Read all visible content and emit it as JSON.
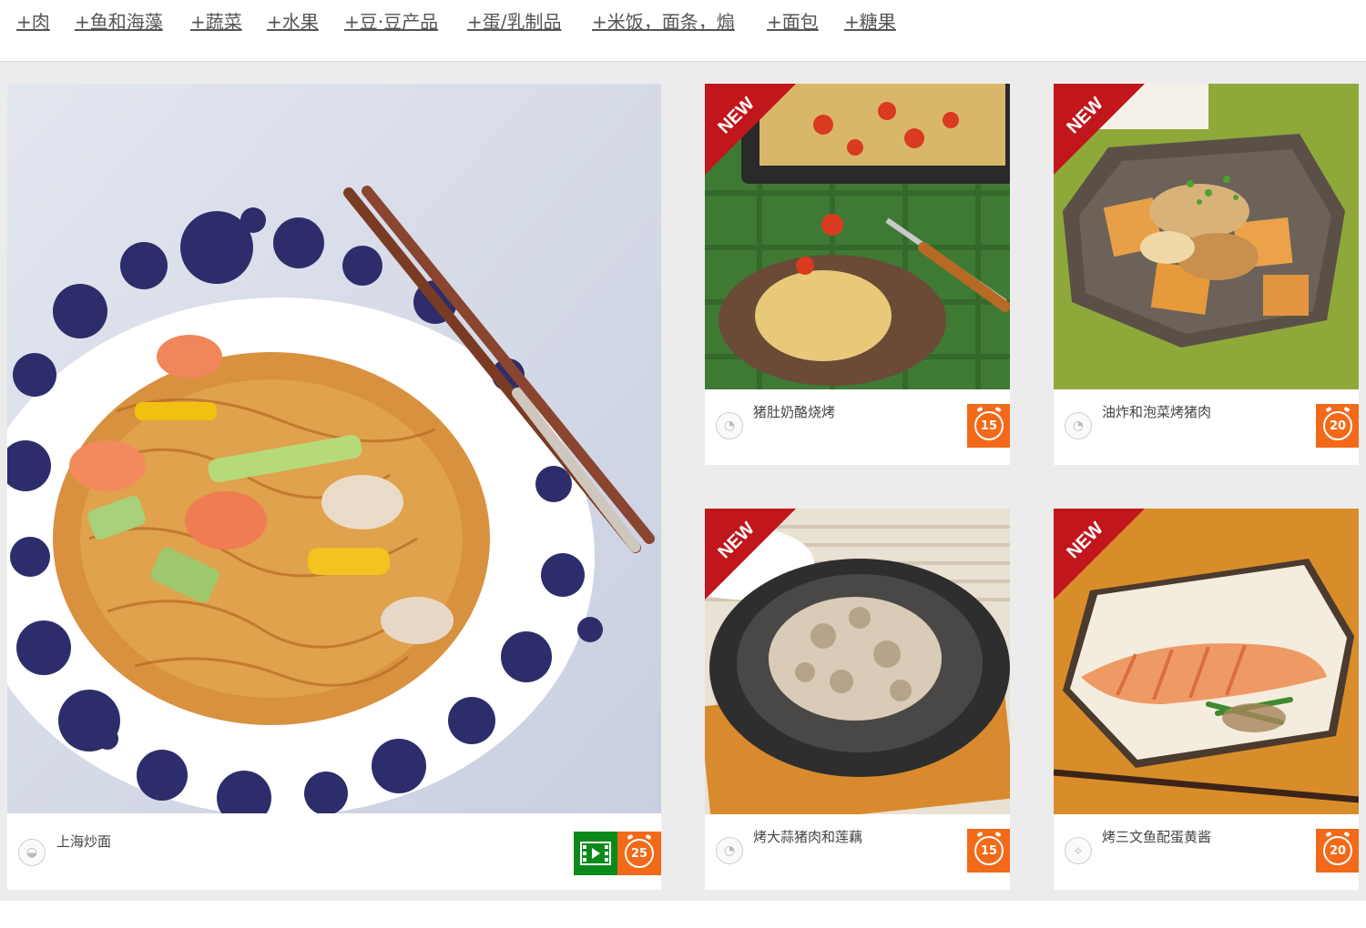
{
  "nav": {
    "links": [
      "+肉",
      "+鱼和海藻",
      "+蔬菜",
      "+水果",
      "+豆·豆产品",
      "+蛋/乳制品",
      "+米饭，面条，煽",
      "+面包",
      "+糖果"
    ]
  },
  "colors": {
    "timer_orange": "#f26a19",
    "video_green": "#0b8a1c",
    "new_badge_red": "#c1161c",
    "grid_bg": "#ececec"
  },
  "cards": {
    "featured": {
      "title": "上海炒面",
      "time": "25",
      "icon": "bowl-icon",
      "has_video": true
    },
    "c1": {
      "title": "猪肚奶酪烧烤",
      "time": "15",
      "icon": "meat-icon",
      "badge": "NEW"
    },
    "c2": {
      "title": "油炸和泡菜烤猪肉",
      "time": "20",
      "icon": "meat-icon",
      "badge": "NEW"
    },
    "c3": {
      "title": "烤大蒜猪肉和莲藕",
      "time": "15",
      "icon": "meat-icon",
      "badge": "NEW"
    },
    "c4": {
      "title": "烤三文鱼配蛋黄酱",
      "time": "20",
      "icon": "fish-icon",
      "badge": "NEW"
    }
  }
}
